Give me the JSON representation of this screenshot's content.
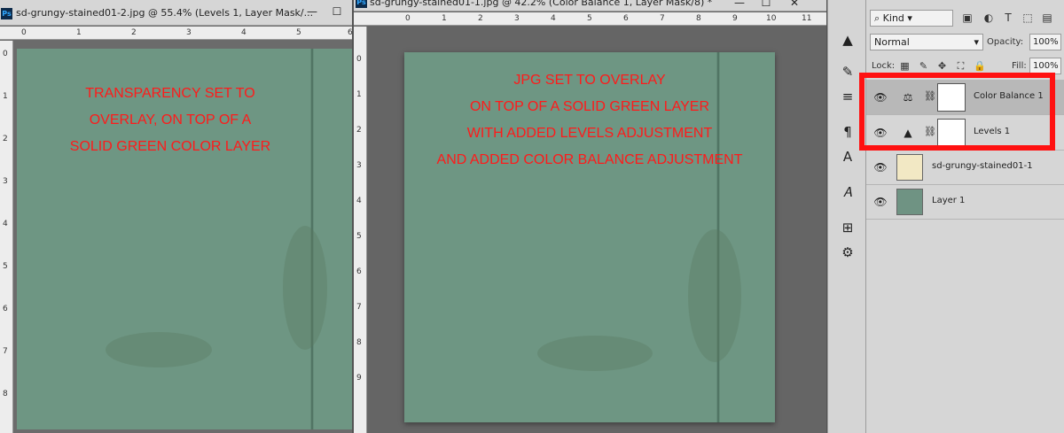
{
  "doc_left": {
    "title": "sd-grungy-stained01-2.jpg @ 55.4% (Levels 1, Layer Mask/...",
    "ruler_top": [
      "0",
      "1",
      "2",
      "3",
      "4",
      "5",
      "6"
    ],
    "ruler_left": [
      "0",
      "1",
      "2",
      "3",
      "4",
      "5",
      "6",
      "7",
      "8"
    ],
    "annotation": [
      "TRANSPARENCY SET TO",
      "OVERLAY, ON TOP OF A",
      "SOLID GREEN COLOR LAYER"
    ]
  },
  "doc_right": {
    "title": "sd-grungy-stained01-1.jpg @ 42.2% (Color Balance 1, Layer Mask/8) *",
    "ruler_top": [
      "0",
      "1",
      "2",
      "3",
      "4",
      "5",
      "6",
      "7",
      "8",
      "9",
      "10",
      "11"
    ],
    "ruler_left": [
      "0",
      "1",
      "2",
      "3",
      "4",
      "5",
      "6",
      "7",
      "8",
      "9"
    ],
    "annotation": [
      "JPG SET TO OVERLAY",
      "ON TOP OF A SOLID GREEN LAYER",
      "WITH ADDED LEVELS ADJUSTMENT",
      "AND ADDED COLOR BALANCE ADJUSTMENT"
    ]
  },
  "window_buttons": {
    "minimize": "—",
    "maximize": "☐",
    "close": "✕"
  },
  "tools": [
    "levels-tool-icon",
    "brush-tool-icon",
    "sliders-tool-icon",
    "paragraph-icon",
    "character-icon",
    "glyph-icon",
    "clone-source-icon",
    "paragraph-styles-icon"
  ],
  "tool_glyphs": [
    "▲",
    "✎",
    "≡",
    "¶",
    "A",
    "𝐴",
    "⊞",
    "⚙"
  ],
  "layers_panel": {
    "filter_kind": "Kind",
    "blend_mode": "Normal",
    "opacity_label": "Opacity:",
    "opacity_value": "100%",
    "lock_label": "Lock:",
    "fill_label": "Fill:",
    "fill_value": "100%",
    "layers": [
      {
        "name": "Color Balance 1",
        "selected": true,
        "kind": "adjustment",
        "icon": "⚖"
      },
      {
        "name": "Levels 1",
        "selected": false,
        "kind": "adjustment",
        "icon": "▲"
      },
      {
        "name": "sd-grungy-stained01-1",
        "selected": false,
        "kind": "image",
        "thumb_color": "#f2e8c4"
      },
      {
        "name": "Layer 1",
        "selected": false,
        "kind": "fill",
        "thumb_color": "#6f9383"
      }
    ]
  },
  "colors": {
    "canvas_green": "#6e9683",
    "annotation_red": "#ff1a1a",
    "highlight_red": "#ff1111"
  }
}
